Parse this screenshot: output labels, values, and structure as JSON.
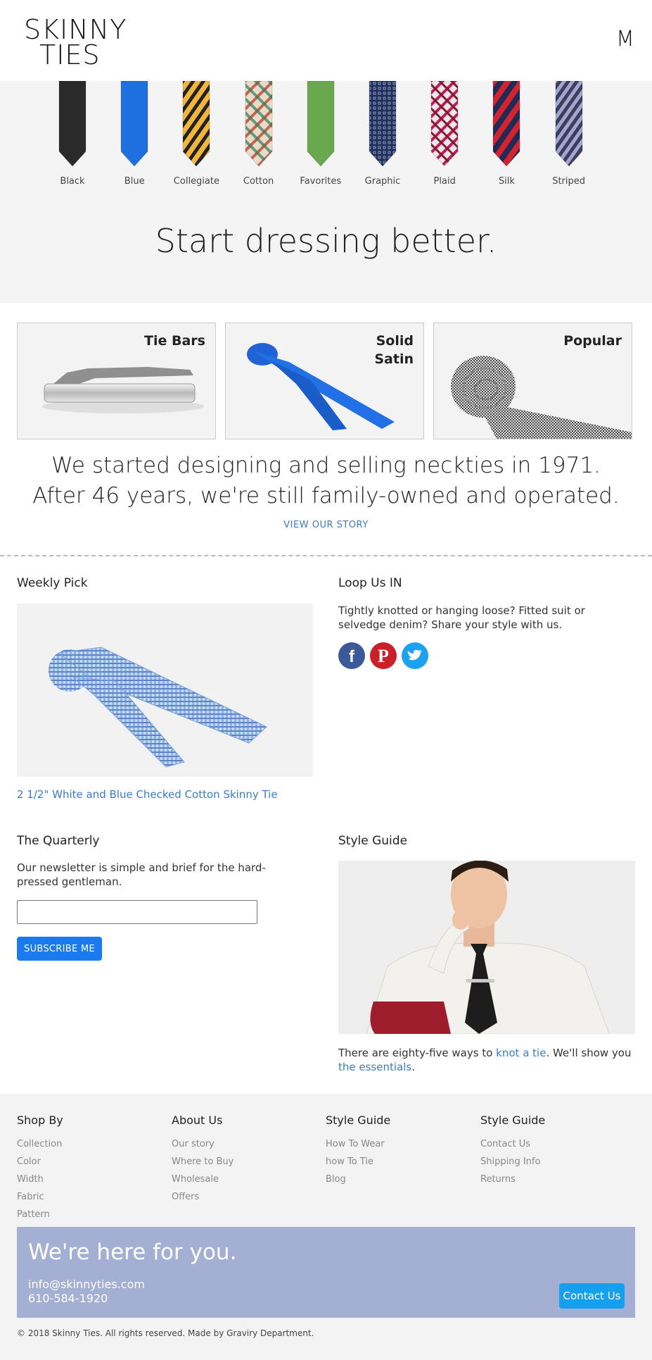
{
  "header": {
    "logo_line1": "SKINNY",
    "logo_line2": "TIES",
    "menu_label": "M"
  },
  "hero": {
    "ties": [
      {
        "label": "Black",
        "color": "#2a2a2a",
        "pattern": "solid"
      },
      {
        "label": "Blue",
        "color": "#1e6fe0",
        "pattern": "solid"
      },
      {
        "label": "Collegiate",
        "color": "#f2b63a",
        "pattern": "stripe-dark"
      },
      {
        "label": "Cotton",
        "color": "#e8dcc8",
        "pattern": "plaid"
      },
      {
        "label": "Favorites",
        "color": "#6aa84f",
        "pattern": "solid"
      },
      {
        "label": "Graphic",
        "color": "#1f2f5a",
        "pattern": "dots"
      },
      {
        "label": "Plaid",
        "color": "#f0e6ea",
        "pattern": "plaid-red"
      },
      {
        "label": "Silk",
        "color": "#1e2c55",
        "pattern": "stripe-red"
      },
      {
        "label": "Striped",
        "color": "#3b3f5e",
        "pattern": "stripe-lav"
      }
    ],
    "title": "Start dressing better."
  },
  "categories": [
    {
      "title_line1": "Tie Bars",
      "title_line2": ""
    },
    {
      "title_line1": "Solid",
      "title_line2": "Satin"
    },
    {
      "title_line1": "Popular",
      "title_line2": ""
    }
  ],
  "story": {
    "line1": "We started designing and selling neckties in 1971.",
    "line2": "After 46 years, we're still family-owned and operated.",
    "link": "VIEW OUR STORY"
  },
  "weekly": {
    "title": "Weekly Pick",
    "product_link": "2 1/2\" White and Blue Checked Cotton Skinny Tie"
  },
  "loop": {
    "title": "Loop Us IN",
    "text": "Tightly knotted or hanging loose? Fitted suit or selvedge denim? Share your style with us.",
    "social": [
      {
        "name": "facebook",
        "color": "#3b5998"
      },
      {
        "name": "pinterest",
        "color": "#cb2027"
      },
      {
        "name": "twitter",
        "color": "#1da1f2"
      }
    ]
  },
  "quarterly": {
    "title": "The Quarterly",
    "text": "Our newsletter is simple and brief for the hard-pressed gentleman.",
    "input_value": "",
    "subscribe_label": "SUBSCRIBE ME"
  },
  "style_guide": {
    "title": "Style Guide",
    "text_before": "There are eighty-five ways to ",
    "link1": "knot a tie",
    "text_middle": ". We'll show you ",
    "link2": "the essentials",
    "text_after": "."
  },
  "footer": {
    "columns": [
      {
        "heading": "Shop By",
        "items": [
          "Collection",
          "Color",
          "Width",
          "Fabric",
          "Pattern"
        ]
      },
      {
        "heading": "About Us",
        "items": [
          "Our story",
          "Where to Buy",
          "Wholesale",
          "Offers"
        ]
      },
      {
        "heading": "Style Guide",
        "items": [
          "How To Wear",
          "how To Tie",
          "Blog"
        ]
      },
      {
        "heading": "Style Guide",
        "items": [
          "Contact Us",
          "Shipping Info",
          "Returns"
        ]
      }
    ],
    "contact": {
      "title": "We're here for you.",
      "email": "info@skinnyties.com",
      "phone": "610-584-1920",
      "button": "Contact Us"
    },
    "copyright": "© 2018 Skinny Ties. All rights reserved. Made by Graviry Department."
  }
}
